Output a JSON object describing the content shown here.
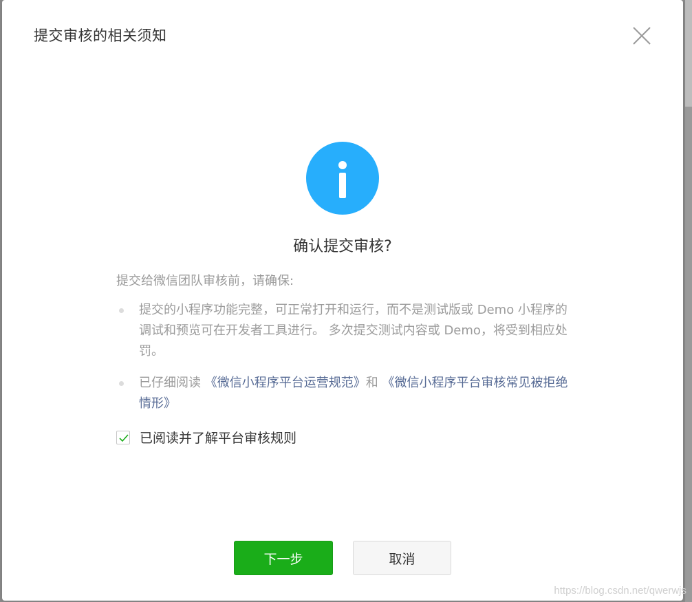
{
  "dialog": {
    "title": "提交审核的相关须知",
    "confirm_title": "确认提交审核?",
    "intro": "提交给微信团队审核前，请确保:",
    "rules": [
      {
        "text": "提交的小程序功能完整，可正常打开和运行，而不是测试版或 Demo 小程序的调试和预览可在开发者工具进行。 多次提交测试内容或 Demo，将受到相应处罚。"
      },
      {
        "prefix": "已仔细阅读 ",
        "link1": "《微信小程序平台运营规范》",
        "middle": "和 ",
        "link2": "《微信小程序平台审核常见被拒绝情形》"
      }
    ],
    "agree_label": "已阅读并了解平台审核规则",
    "agree_checked": true,
    "next_button": "下一步",
    "cancel_button": "取消"
  },
  "watermark": "https://blog.csdn.net/qwerwjs",
  "colors": {
    "accent_green": "#1aad19",
    "info_blue": "#27aefc",
    "link_blue": "#576b95",
    "muted_text": "#9b9b9b"
  },
  "icons": {
    "close": "close-icon",
    "info": "info-icon",
    "check": "checkmark-icon"
  }
}
